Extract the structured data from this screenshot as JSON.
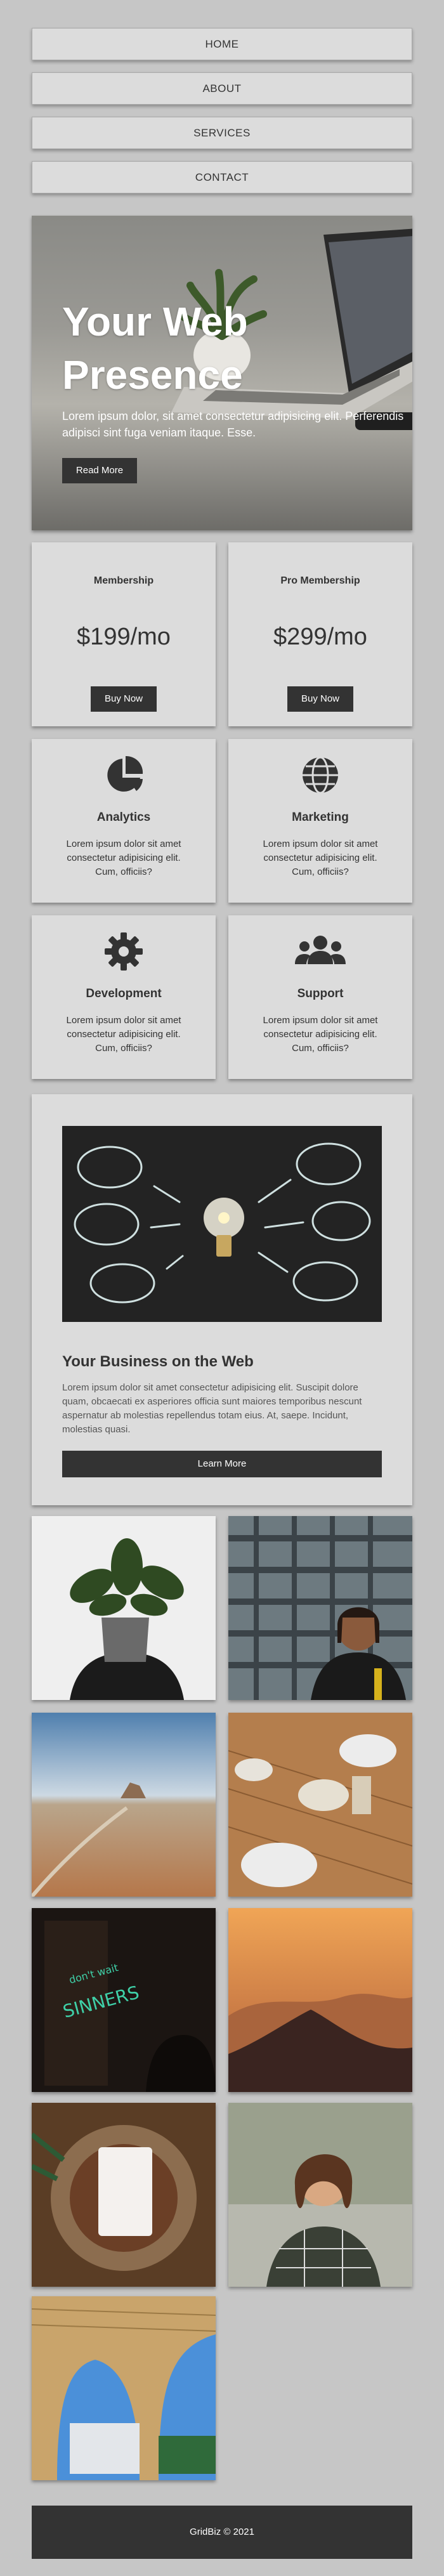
{
  "nav": {
    "items": [
      {
        "label": "HOME"
      },
      {
        "label": "ABOUT"
      },
      {
        "label": "SERVICES"
      },
      {
        "label": "CONTACT"
      }
    ]
  },
  "hero": {
    "title": "Your Web Presence",
    "text": "Lorem ipsum dolor, sit amet consectetur adipisicing elit. Perferendis adipisci sint fuga veniam itaque. Esse.",
    "button_label": "Read More"
  },
  "pricing": [
    {
      "title": "Membership",
      "price": "$199/mo",
      "button_label": "Buy Now"
    },
    {
      "title": "Pro Membership",
      "price": "$299/mo",
      "button_label": "Buy Now"
    }
  ],
  "services": [
    {
      "icon": "pie-chart-icon",
      "title": "Analytics",
      "text": "Lorem ipsum dolor sit amet consectetur adipisicing elit. Cum, officiis?"
    },
    {
      "icon": "globe-icon",
      "title": "Marketing",
      "text": "Lorem ipsum dolor sit amet consectetur adipisicing elit. Cum, officiis?"
    },
    {
      "icon": "gear-icon",
      "title": "Development",
      "text": "Lorem ipsum dolor sit amet consectetur adipisicing elit. Cum, officiis?"
    },
    {
      "icon": "users-icon",
      "title": "Support",
      "text": "Lorem ipsum dolor sit amet consectetur adipisicing elit. Cum, officiis?"
    }
  ],
  "business": {
    "title": "Your Business on the Web",
    "text": "Lorem ipsum dolor sit amet consectetur adipisicing elit. Suscipit dolore quam, obcaecati ex asperiores officia sunt maiores temporibus nescunt aspernatur ab molestias repellendus totam eius. At, saepe. Incidunt, molestias quasi.",
    "button_label": "Learn More"
  },
  "footer": {
    "text": "GridBiz © 2021"
  },
  "colors": {
    "page_bg": "#c6c6c6",
    "card_bg": "#dcdcdc",
    "dark": "#333333",
    "text": "#333333"
  }
}
